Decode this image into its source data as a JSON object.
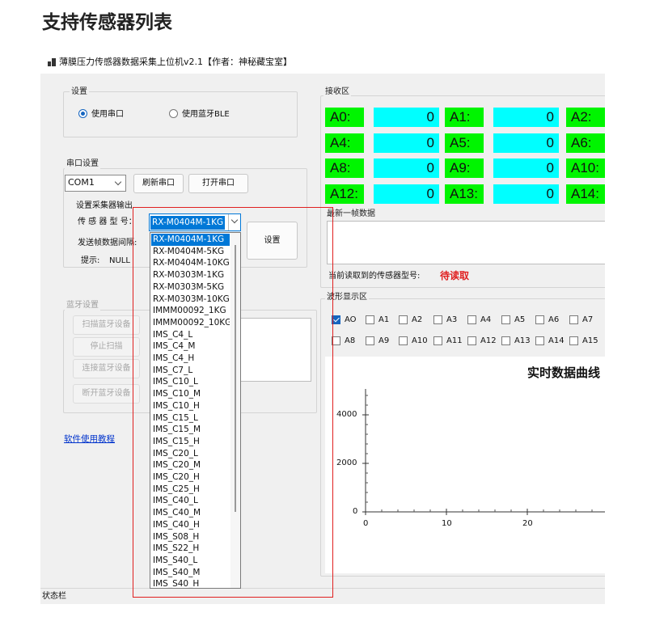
{
  "page_heading": "支持传感器列表",
  "window": {
    "title": "薄膜压力传感器数据采集上位机v2.1【作者：神秘藏宝室】"
  },
  "settings": {
    "group_label": "设置",
    "use_serial": "使用串口",
    "use_ble": "使用蓝牙BLE",
    "selected_mode": "serial"
  },
  "serial": {
    "group_label": "串口设置",
    "port": "COM1",
    "refresh_button": "刷新串口",
    "open_button": "打开串口",
    "collector_label": "设置采集器输出",
    "sensor_model_label": "传 感 器 型 号：",
    "sensor_model_value": "RX-M0404M-1KG",
    "interval_label": "发送帧数据间隔:",
    "hint_label": "提示:",
    "hint_value": "NULL",
    "set_button": "设置"
  },
  "bluetooth": {
    "group_label": "蓝牙设置",
    "scan_button": "扫描蓝牙设备",
    "stop_button": "停止扫描",
    "connect_button": "连接蓝牙设备",
    "disconnect_button": "断开蓝牙设备"
  },
  "tutorial_link": "软件使用教程",
  "receive": {
    "group_label": "接收区",
    "rows": [
      [
        {
          "key": "A0:",
          "value": "0"
        },
        {
          "key": "A1:",
          "value": "0"
        },
        {
          "key": "A2:"
        }
      ],
      [
        {
          "key": "A4:",
          "value": "0"
        },
        {
          "key": "A5:",
          "value": "0"
        },
        {
          "key": "A6:"
        }
      ],
      [
        {
          "key": "A8:",
          "value": "0"
        },
        {
          "key": "A9:",
          "value": "0"
        },
        {
          "key": "A10:"
        }
      ],
      [
        {
          "key": "A12:",
          "value": "0"
        },
        {
          "key": "A13:",
          "value": "0"
        },
        {
          "key": "A14:"
        }
      ]
    ],
    "latest_frame_label": "最新一帧数据",
    "current_model_label": "当前读取到的传感器型号:",
    "current_model_value": "待读取"
  },
  "waveform": {
    "group_label": "波形显示区",
    "channels": [
      {
        "label": "AO",
        "checked": true
      },
      {
        "label": "A1",
        "checked": false
      },
      {
        "label": "A2",
        "checked": false
      },
      {
        "label": "A3",
        "checked": false
      },
      {
        "label": "A4",
        "checked": false
      },
      {
        "label": "A5",
        "checked": false
      },
      {
        "label": "A6",
        "checked": false
      },
      {
        "label": "A7",
        "checked": false
      },
      {
        "label": "A8",
        "checked": false
      },
      {
        "label": "A9",
        "checked": false
      },
      {
        "label": "A10",
        "checked": false
      },
      {
        "label": "A11",
        "checked": false
      },
      {
        "label": "A12",
        "checked": false
      },
      {
        "label": "A13",
        "checked": false
      },
      {
        "label": "A14",
        "checked": false
      },
      {
        "label": "A15",
        "checked": false
      }
    ],
    "chart_title": "实时数据曲线",
    "y_ticks": [
      "4000",
      "2000",
      "0"
    ],
    "x_ticks": [
      "0",
      "10",
      "20"
    ]
  },
  "dropdown_options": [
    "RX-M0404M-1KG",
    "RX-M0404M-5KG",
    "RX-M0404M-10KG",
    "RX-M0303M-1KG",
    "RX-M0303M-5KG",
    "RX-M0303M-10KG",
    "IMMM00092_1KG",
    "IMMM00092_10KG",
    "IMS_C4_L",
    "IMS_C4_M",
    "IMS_C4_H",
    "IMS_C7_L",
    "IMS_C10_L",
    "IMS_C10_M",
    "IMS_C10_H",
    "IMS_C15_L",
    "IMS_C15_M",
    "IMS_C15_H",
    "IMS_C20_L",
    "IMS_C20_M",
    "IMS_C20_H",
    "IMS_C25_H",
    "IMS_C40_L",
    "IMS_C40_M",
    "IMS_C40_H",
    "IMS_S08_H",
    "IMS_S22_H",
    "IMS_S40_L",
    "IMS_S40_M",
    "IMS_S40_H"
  ],
  "dropdown_selected_index": 0,
  "status_bar": "状态栏",
  "colors": {
    "key_bg": "#00f500",
    "value_bg": "#00ffff",
    "accent": "#0078d7",
    "pending_text": "#e02020",
    "highlight_border": "#e02020"
  }
}
